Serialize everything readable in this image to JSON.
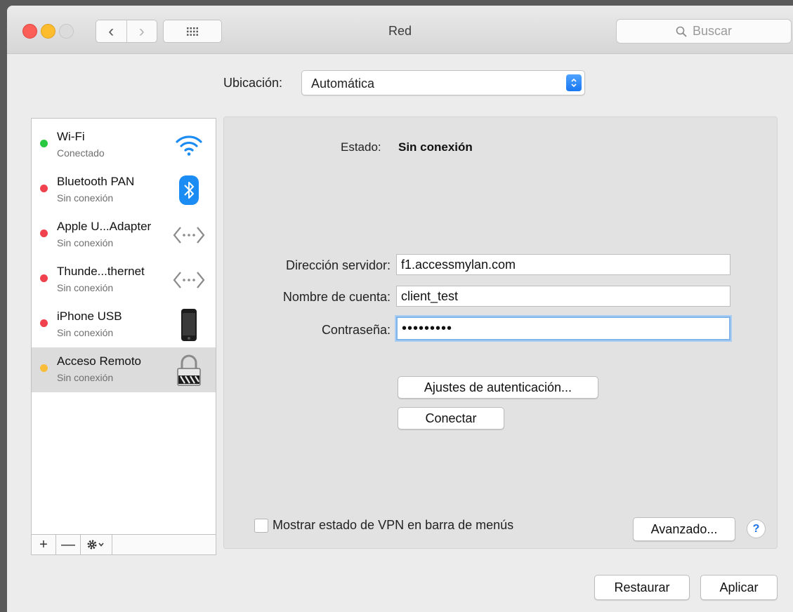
{
  "window": {
    "title": "Red"
  },
  "toolbar": {
    "search_placeholder": "Buscar"
  },
  "location": {
    "label": "Ubicación:",
    "value": "Automática"
  },
  "services": [
    {
      "name": "Wi-Fi",
      "status": "Conectado",
      "status_color": "#28c840",
      "icon": "wifi-icon"
    },
    {
      "name": "Bluetooth PAN",
      "status": "Sin conexión",
      "status_color": "#f0414e",
      "icon": "bluetooth-icon"
    },
    {
      "name": "Apple U...Adapter",
      "status": "Sin conexión",
      "status_color": "#f0414e",
      "icon": "ethernet-icon"
    },
    {
      "name": "Thunde...thernet",
      "status": "Sin conexión",
      "status_color": "#f0414e",
      "icon": "ethernet-icon"
    },
    {
      "name": "iPhone USB",
      "status": "Sin conexión",
      "status_color": "#f0414e",
      "icon": "iphone-icon"
    },
    {
      "name": "Acceso Remoto",
      "status": "Sin conexión",
      "status_color": "#f9bd3a",
      "icon": "vpn-lock-icon",
      "selected": true
    }
  ],
  "sidebar_controls": {
    "add": "+",
    "remove": "—"
  },
  "detail": {
    "status_label": "Estado:",
    "status_value": "Sin conexión",
    "server_label": "Dirección servidor:",
    "server_value": "f1.accessmylan.com",
    "account_label": "Nombre de cuenta:",
    "account_value": "client_test",
    "password_label": "Contraseña:",
    "password_value": "•••••••••",
    "auth_button": "Ajustes de autenticación...",
    "connect_button": "Conectar",
    "vpn_checkbox_label": "Mostrar estado de VPN en barra de menús",
    "vpn_checkbox_checked": false,
    "advanced_button": "Avanzado...",
    "help": "?"
  },
  "footer": {
    "revert_button": "Restaurar",
    "apply_button": "Aplicar"
  }
}
